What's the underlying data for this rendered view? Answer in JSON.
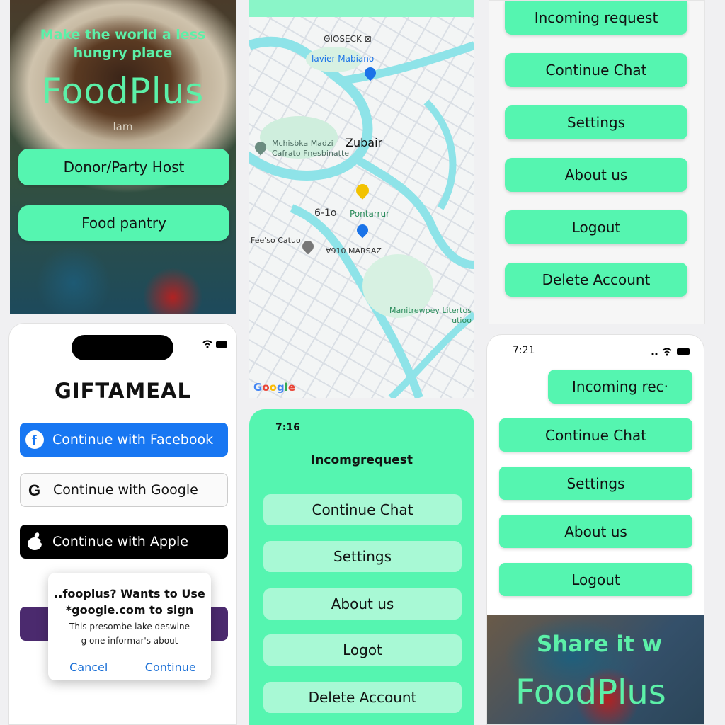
{
  "splash": {
    "tagline": "Make the world a less hungry place",
    "brand": "FoodPlus",
    "small_text": "lam",
    "donor_button": "Donor/Party Host",
    "pantry_button": "Food pantry"
  },
  "map": {
    "labels": {
      "top_code": "ΘIOSECK ⊠",
      "place_top": "lavier Mabiano",
      "zubair": "Zubair",
      "left_place": "Mchisbka Madzi\nCafrato Fnesbinatte",
      "number": "6-1o",
      "pontarrur": "Pontarrur",
      "feeso": "Fee'so Catuo",
      "marsaz": "Ɐ910 MARSAZ",
      "bottom_right": "Manitrewpey Litertos\nɑtioo"
    },
    "google": [
      "G",
      "o",
      "o",
      "g",
      "l",
      "e"
    ],
    "google_colors": [
      "#4285F4",
      "#EA4335",
      "#FBBC05",
      "#4285F4",
      "#34A853",
      "#EA4335"
    ]
  },
  "menu1": {
    "items": [
      "Incoming request",
      "Continue Chat",
      "Settings",
      "About us",
      "Logout",
      "Delete Account"
    ]
  },
  "login": {
    "title": "GIFTAMEAL",
    "facebook": "Continue with Facebook",
    "google": "Continue with Google",
    "apple": "Continue with Apple",
    "dialog": {
      "title_line1": "..fooplus? Wants to Use",
      "title_line2": "*google.com to sign",
      "body_line1": "This presombe lake deswine",
      "body_line2": "g one informar's about",
      "cancel": "Cancel",
      "continue": "Continue"
    },
    "colors": {
      "facebook": "#1877F2",
      "apple": "#000000",
      "hidden_button": "#4b2a6e"
    }
  },
  "menu2": {
    "time": "7:16",
    "heading": "Incomgrequest",
    "items": [
      "Continue Chat",
      "Settings",
      "About us",
      "Logot",
      "Delete Account"
    ]
  },
  "menu3": {
    "time": "7:21",
    "items": [
      "Incoming rec·",
      "Continue Chat",
      "Settings",
      "About us",
      "Logout"
    ],
    "share_line1": "Share it w",
    "share_line2": "FoodPlus"
  },
  "colors": {
    "accent_green": "#55F5B0",
    "brand_text": "#5CF0A8"
  }
}
